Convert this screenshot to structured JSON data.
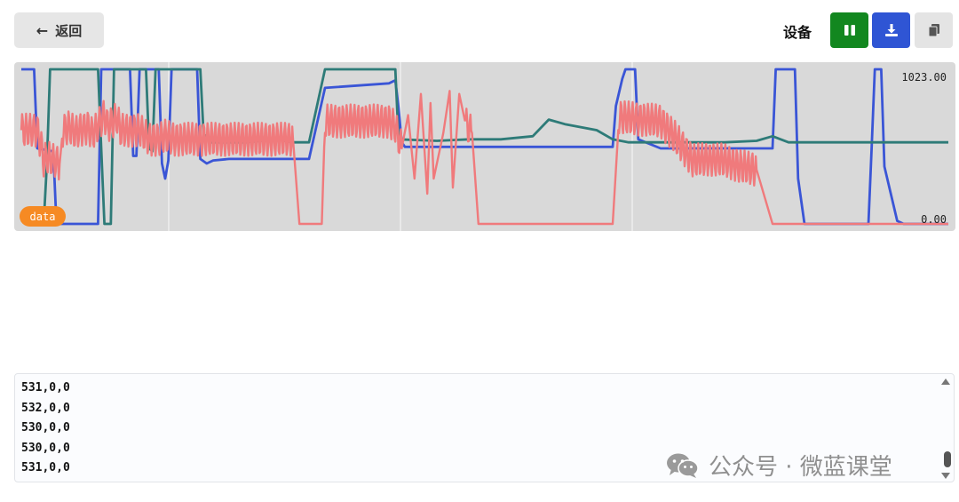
{
  "toolbar": {
    "back_label": "返回",
    "device_label": "设备",
    "colors": {
      "pause": "#12871f",
      "download": "#2f55d4",
      "copy": "#e4e4e4"
    },
    "icons": [
      "arrow-left-icon",
      "pause-icon",
      "download-icon",
      "copy-icon"
    ]
  },
  "chart_data": {
    "type": "line",
    "ylim": [
      0,
      1023
    ],
    "y_max_label": "1023.00",
    "y_min_label": "0.00",
    "legend": "data",
    "legend_color": "#f68a23",
    "grid": true,
    "background": "#d9d9d9",
    "series": [
      {
        "color": "#3a55d6",
        "points": [
          [
            0,
            1023
          ],
          [
            8,
            1023
          ],
          [
            10,
            500
          ],
          [
            20,
            480
          ],
          [
            22,
            0
          ],
          [
            48,
            0
          ],
          [
            50,
            1023
          ],
          [
            68,
            1023
          ],
          [
            70,
            450
          ],
          [
            72,
            450
          ],
          [
            74,
            1023
          ],
          [
            86,
            1023
          ],
          [
            88,
            400
          ],
          [
            90,
            300
          ],
          [
            92,
            420
          ],
          [
            94,
            1023
          ],
          [
            110,
            1023
          ],
          [
            112,
            430
          ],
          [
            116,
            400
          ],
          [
            120,
            420
          ],
          [
            130,
            430
          ],
          [
            140,
            430
          ],
          [
            150,
            430
          ],
          [
            160,
            430
          ],
          [
            170,
            430
          ],
          [
            180,
            430
          ],
          [
            190,
            900
          ],
          [
            230,
            930
          ],
          [
            234,
            950
          ],
          [
            236,
            770
          ],
          [
            238,
            540
          ],
          [
            240,
            510
          ],
          [
            260,
            510
          ],
          [
            280,
            510
          ],
          [
            300,
            510
          ],
          [
            320,
            510
          ],
          [
            340,
            510
          ],
          [
            360,
            510
          ],
          [
            370,
            510
          ],
          [
            372,
            780
          ],
          [
            376,
            960
          ],
          [
            378,
            1023
          ],
          [
            384,
            1023
          ],
          [
            386,
            560
          ],
          [
            400,
            500
          ],
          [
            420,
            500
          ],
          [
            440,
            500
          ],
          [
            460,
            500
          ],
          [
            470,
            500
          ],
          [
            472,
            1023
          ],
          [
            484,
            1023
          ],
          [
            486,
            300
          ],
          [
            490,
            0
          ],
          [
            520,
            0
          ],
          [
            530,
            0
          ],
          [
            532,
            500
          ],
          [
            534,
            1023
          ],
          [
            538,
            1023
          ],
          [
            540,
            380
          ],
          [
            548,
            20
          ],
          [
            552,
            0
          ],
          [
            580,
            0
          ]
        ]
      },
      {
        "color": "#2e7b78",
        "points": [
          [
            0,
            20
          ],
          [
            14,
            0
          ],
          [
            16,
            400
          ],
          [
            18,
            1023
          ],
          [
            48,
            1023
          ],
          [
            50,
            500
          ],
          [
            52,
            0
          ],
          [
            56,
            0
          ],
          [
            58,
            1023
          ],
          [
            78,
            1023
          ],
          [
            80,
            500
          ],
          [
            82,
            480
          ],
          [
            84,
            1023
          ],
          [
            112,
            1023
          ],
          [
            114,
            600
          ],
          [
            118,
            540
          ],
          [
            140,
            540
          ],
          [
            150,
            550
          ],
          [
            160,
            560
          ],
          [
            170,
            540
          ],
          [
            180,
            540
          ],
          [
            190,
            1023
          ],
          [
            230,
            1023
          ],
          [
            234,
            1023
          ],
          [
            236,
            560
          ],
          [
            260,
            550
          ],
          [
            280,
            560
          ],
          [
            300,
            560
          ],
          [
            320,
            580
          ],
          [
            330,
            690
          ],
          [
            340,
            660
          ],
          [
            350,
            640
          ],
          [
            360,
            620
          ],
          [
            370,
            560
          ],
          [
            380,
            540
          ],
          [
            400,
            540
          ],
          [
            420,
            540
          ],
          [
            440,
            540
          ],
          [
            460,
            550
          ],
          [
            470,
            580
          ],
          [
            480,
            540
          ],
          [
            500,
            540
          ],
          [
            520,
            540
          ],
          [
            540,
            540
          ],
          [
            560,
            540
          ],
          [
            580,
            540
          ]
        ]
      },
      {
        "color": "#f07a7c",
        "points": [
          [
            0,
            620
          ],
          [
            10,
            620
          ],
          [
            12,
            540
          ],
          [
            14,
            420
          ],
          [
            16,
            440
          ],
          [
            24,
            400
          ],
          [
            26,
            620
          ],
          [
            30,
            640
          ],
          [
            34,
            600
          ],
          [
            36,
            620
          ],
          [
            42,
            640
          ],
          [
            44,
            600
          ],
          [
            46,
            610
          ],
          [
            52,
            720
          ],
          [
            54,
            650
          ],
          [
            60,
            700
          ],
          [
            62,
            620
          ],
          [
            68,
            620
          ],
          [
            74,
            620
          ],
          [
            80,
            560
          ],
          [
            86,
            560
          ],
          [
            90,
            580
          ],
          [
            96,
            560
          ],
          [
            104,
            560
          ],
          [
            112,
            560
          ],
          [
            120,
            560
          ],
          [
            130,
            560
          ],
          [
            140,
            560
          ],
          [
            150,
            560
          ],
          [
            160,
            560
          ],
          [
            170,
            560
          ],
          [
            174,
            0
          ],
          [
            188,
            0
          ],
          [
            190,
            680
          ],
          [
            200,
            680
          ],
          [
            220,
            680
          ],
          [
            230,
            680
          ],
          [
            234,
            640
          ],
          [
            238,
            500
          ],
          [
            242,
            720
          ],
          [
            246,
            300
          ],
          [
            250,
            860
          ],
          [
            254,
            200
          ],
          [
            256,
            800
          ],
          [
            258,
            300
          ],
          [
            264,
            600
          ],
          [
            268,
            880
          ],
          [
            270,
            240
          ],
          [
            274,
            860
          ],
          [
            278,
            660
          ],
          [
            282,
            600
          ],
          [
            286,
            0
          ],
          [
            300,
            0
          ],
          [
            320,
            0
          ],
          [
            340,
            0
          ],
          [
            360,
            0
          ],
          [
            370,
            0
          ],
          [
            374,
            710
          ],
          [
            380,
            700
          ],
          [
            390,
            690
          ],
          [
            400,
            680
          ],
          [
            410,
            560
          ],
          [
            420,
            420
          ],
          [
            430,
            430
          ],
          [
            440,
            420
          ],
          [
            450,
            380
          ],
          [
            460,
            360
          ],
          [
            470,
            0
          ],
          [
            480,
            0
          ],
          [
            500,
            0
          ],
          [
            520,
            0
          ],
          [
            540,
            0
          ],
          [
            560,
            0
          ],
          [
            580,
            0
          ]
        ]
      }
    ]
  },
  "log": {
    "lines": [
      "531,0,0",
      "532,0,0",
      "530,0,0",
      "530,0,0",
      "531,0,0"
    ]
  },
  "watermark": {
    "text": "公众号 · 微蓝课堂"
  }
}
